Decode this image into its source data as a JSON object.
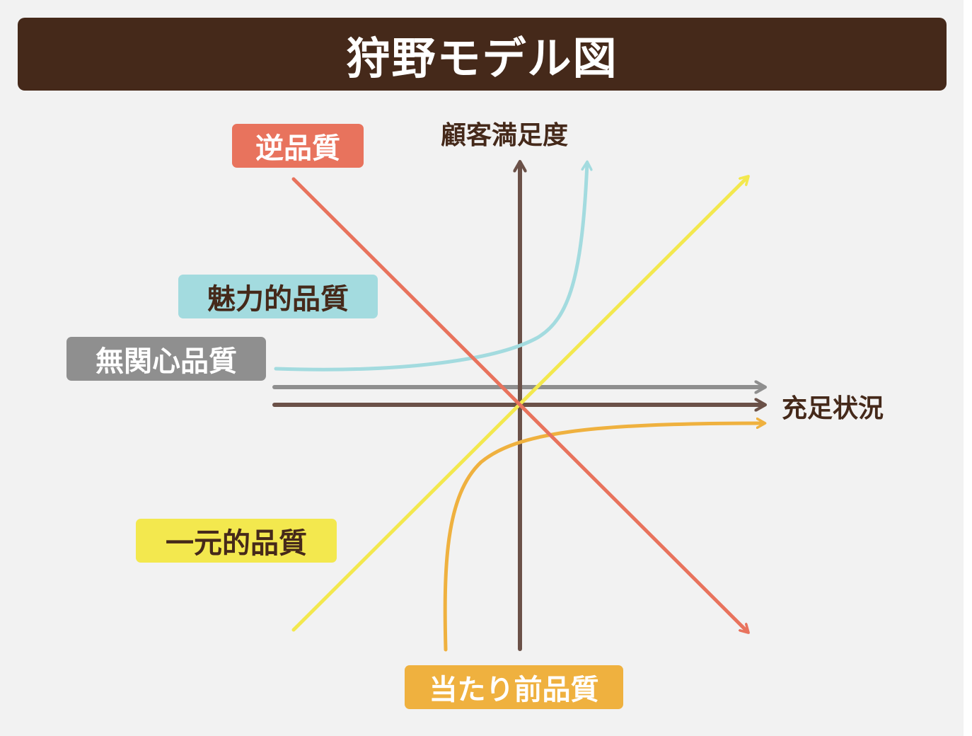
{
  "title": "狩野モデル図",
  "axes": {
    "y_label": "顧客満足度",
    "x_label": "充足状況"
  },
  "labels": {
    "reverse": "逆品質",
    "attractive": "魅力的品質",
    "indifferent": "無関心品質",
    "one_dimensional": "一元的品質",
    "must_be": "当たり前品質"
  },
  "colors": {
    "title_bg": "#45291a",
    "background": "#f2f2f2",
    "axis": "#6b5148",
    "reverse": "#e8735d",
    "attractive": "#a3dbdf",
    "indifferent": "#8f8f8f",
    "one_dimensional": "#f3e84e",
    "must_be": "#efb13f"
  }
}
